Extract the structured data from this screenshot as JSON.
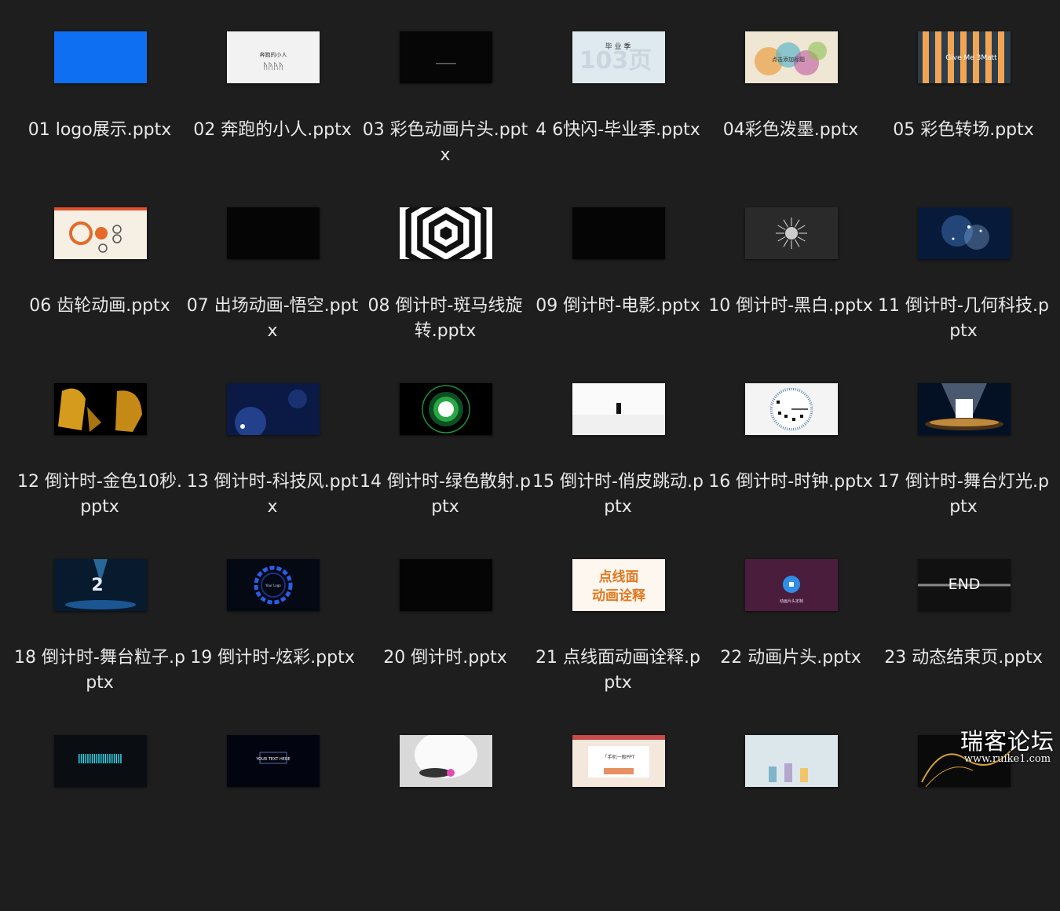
{
  "files": [
    {
      "name": "01 logo展示.pptx",
      "thumb": "blue"
    },
    {
      "name": "02 奔跑的小人.pptx",
      "thumb": "runners",
      "thumb_text": "奔跑的小人"
    },
    {
      "name": "03 彩色动画片头.pptx",
      "thumb": "black_text"
    },
    {
      "name": "4 6快闪-毕业季.pptx",
      "thumb": "graduation",
      "thumb_text": "103页",
      "thumb_text2": "毕 业 季"
    },
    {
      "name": "04彩色泼墨.pptx",
      "thumb": "ink",
      "thumb_text": "点击添加标题"
    },
    {
      "name": "05 彩色转场.pptx",
      "thumb": "stripes",
      "thumb_text": "Give Me 3Matt"
    },
    {
      "name": "06 齿轮动画.pptx",
      "thumb": "gears"
    },
    {
      "name": "07 出场动画-悟空.pptx",
      "thumb": "black"
    },
    {
      "name": "08 倒计时-斑马线旋转.pptx",
      "thumb": "zebra"
    },
    {
      "name": "09 倒计时-电影.pptx",
      "thumb": "black"
    },
    {
      "name": "10 倒计时-黑白.pptx",
      "thumb": "sun"
    },
    {
      "name": "11 倒计时-几何科技.pptx",
      "thumb": "geo"
    },
    {
      "name": "12 倒计时-金色10秒.pptx",
      "thumb": "gold"
    },
    {
      "name": "13 倒计时-科技风.pptx",
      "thumb": "techblue"
    },
    {
      "name": "14 倒计时-绿色散射.pptx",
      "thumb": "greenradial"
    },
    {
      "name": "15 倒计时-俏皮跳动.pptx",
      "thumb": "whitebar"
    },
    {
      "name": "16 倒计时-时钟.pptx",
      "thumb": "clock"
    },
    {
      "name": "17 倒计时-舞台灯光.pptx",
      "thumb": "stage"
    },
    {
      "name": "18 倒计时-舞台粒子.pptx",
      "thumb": "particles"
    },
    {
      "name": "19 倒计时-炫彩.pptx",
      "thumb": "ring",
      "thumb_text": "Your Logo"
    },
    {
      "name": "20 倒计时.pptx",
      "thumb": "black"
    },
    {
      "name": "21 点线面动画诠释.pptx",
      "thumb": "dotline",
      "thumb_text": "点线面",
      "thumb_text2": "动画诠释"
    },
    {
      "name": "22 动画片头.pptx",
      "thumb": "purple",
      "thumb_text": "动画片头定制"
    },
    {
      "name": "23 动态结束页.pptx",
      "thumb": "end",
      "thumb_text": "END"
    },
    {
      "name": "",
      "thumb": "bars"
    },
    {
      "name": "",
      "thumb": "yourtext",
      "thumb_text": "YOUR TEXT HERE"
    },
    {
      "name": "",
      "thumb": "spotlight"
    },
    {
      "name": "",
      "thumb": "envelope",
      "thumb_text": "「手机一般PPT"
    },
    {
      "name": "",
      "thumb": "lab"
    },
    {
      "name": "",
      "thumb": "goldline"
    }
  ],
  "watermark": {
    "title": "瑞客论坛",
    "url": "www.ruike1.com"
  }
}
